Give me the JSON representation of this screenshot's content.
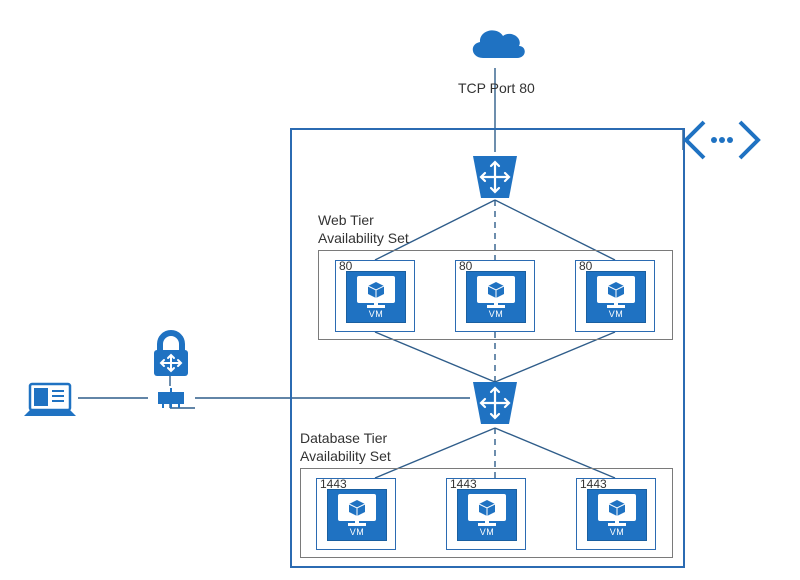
{
  "diagram": {
    "cloud_label": "TCP Port 80",
    "web_tier": {
      "title_line1": "Web Tier",
      "title_line2": "Availability Set",
      "vm_port": "80",
      "vm_label": "VM"
    },
    "db_tier": {
      "title_line1": "Database Tier",
      "title_line2": "Availability Set",
      "vm_port": "1443",
      "vm_label": "VM"
    },
    "colors": {
      "azure_blue": "#1f72c2",
      "border_blue": "#2b6bb2",
      "line": "#2f5d8a"
    },
    "icons": {
      "cloud": "cloud",
      "load_balancer_top": "load-balancer",
      "load_balancer_bottom": "load-balancer",
      "vnet_brackets": "vnet-peering",
      "firewall": "network-firewall",
      "hub": "network-hub",
      "laptop": "client-laptop",
      "vm": "virtual-machine",
      "cube": "package-cube"
    }
  }
}
